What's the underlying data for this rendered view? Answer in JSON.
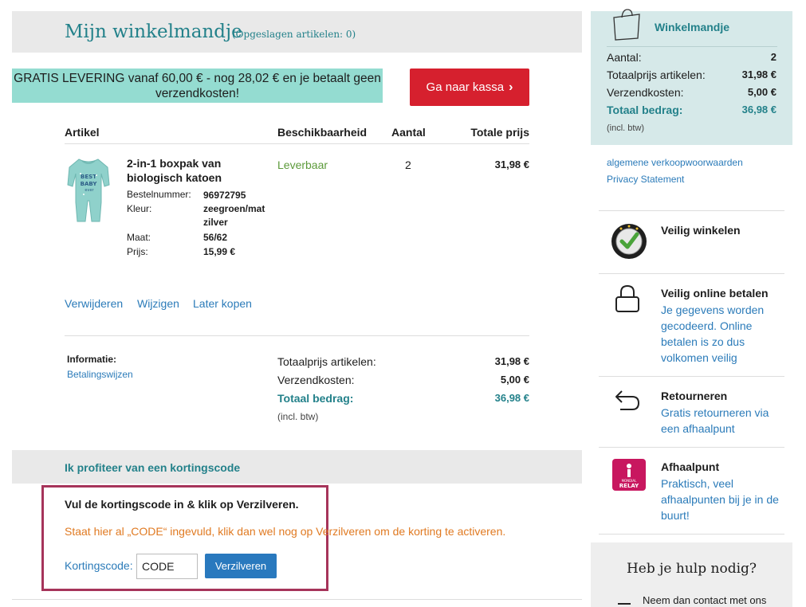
{
  "header": {
    "title": "Mijn winkelmandje",
    "saved": "(Opgeslagen artikelen: 0)"
  },
  "promo": {
    "text": "GRATIS LEVERING vanaf 60,00 € - nog 28,02 € en je betaalt geen verzendkosten!"
  },
  "checkout": {
    "label": "Ga naar kassa",
    "chevron": "›"
  },
  "table": {
    "headers": {
      "article": "Artikel",
      "availability": "Beschikbaarheid",
      "quantity": "Aantal",
      "total": "Totale prijs"
    }
  },
  "product": {
    "image_icon": "baby-romper-image",
    "name": "2-in-1 boxpak van biologisch katoen",
    "specs": [
      {
        "label": "Bestelnummer:",
        "value": "96972795"
      },
      {
        "label": "Kleur:",
        "value": "zeegroen/mat zilver"
      },
      {
        "label": "Maat:",
        "value": "56/62"
      },
      {
        "label": "Prijs:",
        "value": "15,99 €"
      }
    ],
    "availability": "Leverbaar",
    "quantity": "2",
    "total": "31,98 €",
    "actions": {
      "remove": "Verwijderen",
      "change": "Wijzigen",
      "later": "Later kopen"
    }
  },
  "info": {
    "label": "Informatie:",
    "link": "Betalingswijzen"
  },
  "totals": {
    "subtotal_label": "Totaalprijs artikelen:",
    "subtotal": "31,98 €",
    "shipping_label": "Verzendkosten:",
    "shipping": "5,00 €",
    "total_label": "Totaal bedrag:",
    "total": "36,98 €",
    "incl": "(incl. btw)"
  },
  "discount": {
    "title": "Ik profiteer van een kortingscode",
    "instruction": "Vul de kortingscode in & klik op Verzilveren.",
    "hint": "Staat hier al „CODE“ ingevuld, klik dan wel nog op Verzilveren om de korting te activeren.",
    "field_label": "Kortingscode:",
    "field_value": "CODE",
    "button": "Verzilveren"
  },
  "summary": {
    "title": "Winkelmandje",
    "rows": [
      {
        "label": "Aantal:",
        "value": "2"
      },
      {
        "label": "Totaalprijs artikelen:",
        "value": "31,98 €"
      },
      {
        "label": "Verzendkosten:",
        "value": "5,00 €"
      },
      {
        "label": "Totaal bedrag:",
        "value": "36,98 €"
      }
    ],
    "incl": "(incl. btw)"
  },
  "legal": {
    "terms": "algemene verkoopwoorwaarden",
    "privacy": "Privacy Statement"
  },
  "features": [
    {
      "icon": "safety-seal-icon",
      "title": "Veilig winkelen",
      "text": ""
    },
    {
      "icon": "lock-icon",
      "title": "Veilig online betalen",
      "text": "Je gegevens worden gecodeerd. Online betalen is zo dus volkomen veilig"
    },
    {
      "icon": "return-arrow-icon",
      "title": "Retourneren",
      "text": "Gratis retourneren via een afhaalpunt"
    },
    {
      "icon": "mondial-relay-icon",
      "title": "Afhaalpunt",
      "text": "Praktisch, veel afhaalpunten bij je in de buurt!"
    }
  ],
  "help": {
    "title": "Heb je hulp nodig?",
    "text": "Neem dan contact met ons"
  },
  "colors": {
    "accent": "#23818a",
    "cta": "#d6202e",
    "link": "#2b7bb9",
    "promo": "#94dcd1",
    "highlight": "#a6345a"
  }
}
